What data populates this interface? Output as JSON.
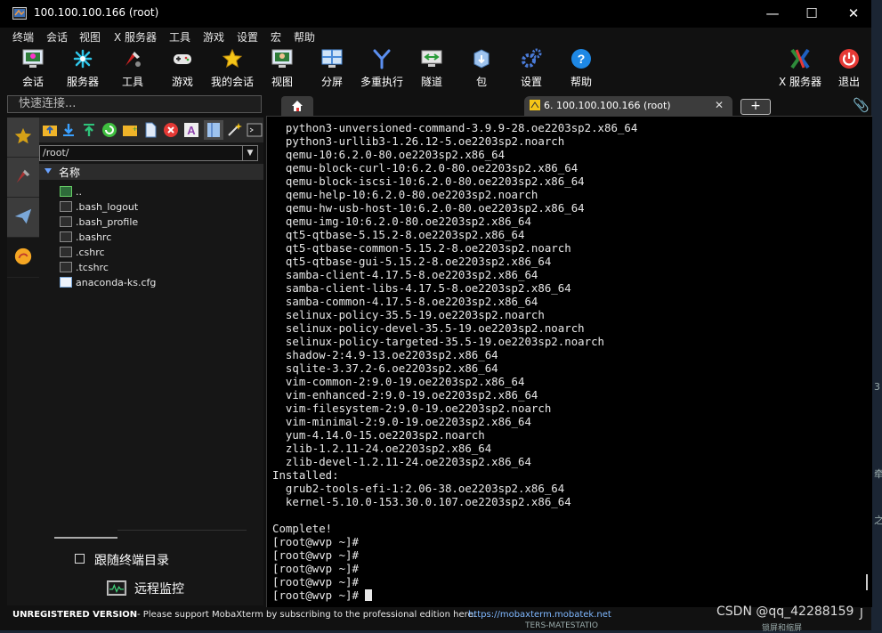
{
  "window": {
    "title": "100.100.100.166 (root)",
    "controls": {
      "minimize": "—",
      "maximize": "☐",
      "close": "✕"
    }
  },
  "menu": [
    "终端",
    "会话",
    "视图",
    "X 服务器",
    "工具",
    "游戏",
    "设置",
    "宏",
    "帮助"
  ],
  "toolbar": {
    "items": [
      {
        "label": "会话",
        "icon": "session-icon"
      },
      {
        "label": "服务器",
        "icon": "servers-icon"
      },
      {
        "label": "工具",
        "icon": "tools-icon"
      },
      {
        "label": "游戏",
        "icon": "games-icon"
      },
      {
        "label": "我的会话",
        "icon": "star-icon"
      },
      {
        "label": "视图",
        "icon": "view-icon"
      },
      {
        "label": "分屏",
        "icon": "split-icon"
      },
      {
        "label": "多重执行",
        "icon": "multiexec-icon"
      },
      {
        "label": "隧道",
        "icon": "tunnel-icon"
      },
      {
        "label": "包",
        "icon": "package-icon"
      },
      {
        "label": "设置",
        "icon": "settings-icon"
      },
      {
        "label": "帮助",
        "icon": "help-icon"
      }
    ],
    "right_items": [
      {
        "label": "X 服务器",
        "icon": "xserver-icon"
      },
      {
        "label": "退出",
        "icon": "power-icon"
      }
    ]
  },
  "quick_connect": {
    "placeholder": "快速连接..."
  },
  "tabs": {
    "home_icon": "home-icon",
    "session_tab": "6. 100.100.100.166 (root)",
    "close": "✕",
    "add": "+"
  },
  "sftp": {
    "path": "/root/",
    "column_name": "名称",
    "files": [
      "..",
      ".bash_logout",
      ".bash_profile",
      ".bashrc",
      ".cshrc",
      ".tcshrc",
      "anaconda-ks.cfg"
    ],
    "follow_terminal_label": "跟随终端目录",
    "remote_monitor_label": "远程监控"
  },
  "terminal": {
    "lines": [
      "  python3-unversioned-command-3.9.9-28.oe2203sp2.x86_64",
      "  python3-urllib3-1.26.12-5.oe2203sp2.noarch",
      "  qemu-10:6.2.0-80.oe2203sp2.x86_64",
      "  qemu-block-curl-10:6.2.0-80.oe2203sp2.x86_64",
      "  qemu-block-iscsi-10:6.2.0-80.oe2203sp2.x86_64",
      "  qemu-help-10:6.2.0-80.oe2203sp2.noarch",
      "  qemu-hw-usb-host-10:6.2.0-80.oe2203sp2.x86_64",
      "  qemu-img-10:6.2.0-80.oe2203sp2.x86_64",
      "  qt5-qtbase-5.15.2-8.oe2203sp2.x86_64",
      "  qt5-qtbase-common-5.15.2-8.oe2203sp2.noarch",
      "  qt5-qtbase-gui-5.15.2-8.oe2203sp2.x86_64",
      "  samba-client-4.17.5-8.oe2203sp2.x86_64",
      "  samba-client-libs-4.17.5-8.oe2203sp2.x86_64",
      "  samba-common-4.17.5-8.oe2203sp2.x86_64",
      "  selinux-policy-35.5-19.oe2203sp2.noarch",
      "  selinux-policy-devel-35.5-19.oe2203sp2.noarch",
      "  selinux-policy-targeted-35.5-19.oe2203sp2.noarch",
      "  shadow-2:4.9-13.oe2203sp2.x86_64",
      "  sqlite-3.37.2-6.oe2203sp2.x86_64",
      "  vim-common-2:9.0-19.oe2203sp2.x86_64",
      "  vim-enhanced-2:9.0-19.oe2203sp2.x86_64",
      "  vim-filesystem-2:9.0-19.oe2203sp2.noarch",
      "  vim-minimal-2:9.0-19.oe2203sp2.x86_64",
      "  yum-4.14.0-15.oe2203sp2.noarch",
      "  zlib-1.2.11-24.oe2203sp2.x86_64",
      "  zlib-devel-1.2.11-24.oe2203sp2.x86_64",
      "Installed:",
      "  grub2-tools-efi-1:2.06-38.oe2203sp2.x86_64",
      "  kernel-5.10.0-153.30.0.107.oe2203sp2.x86_64",
      "",
      "Complete!",
      "[root@wvp ~]#",
      "[root@wvp ~]#",
      "[root@wvp ~]#",
      "[root@wvp ~]#"
    ],
    "last_prompt": "[root@wvp ~]# "
  },
  "status": {
    "unregistered": "UNREGISTERED VERSION",
    "message": "-  Please support MobaXterm by subscribing to the professional edition here:",
    "url": "https://mobaxterm.mobatek.net"
  },
  "watermark": "CSDN @qq_42288159",
  "background_fragments": [
    "TERS-MATESTATIO",
    "锁屏和缩屏",
    "J",
    "3",
    "牵",
    "之"
  ],
  "colors": {
    "accent_blue": "#4a8bd8",
    "terminal_bg": "#000000",
    "terminal_fg": "#e8e8e8"
  }
}
